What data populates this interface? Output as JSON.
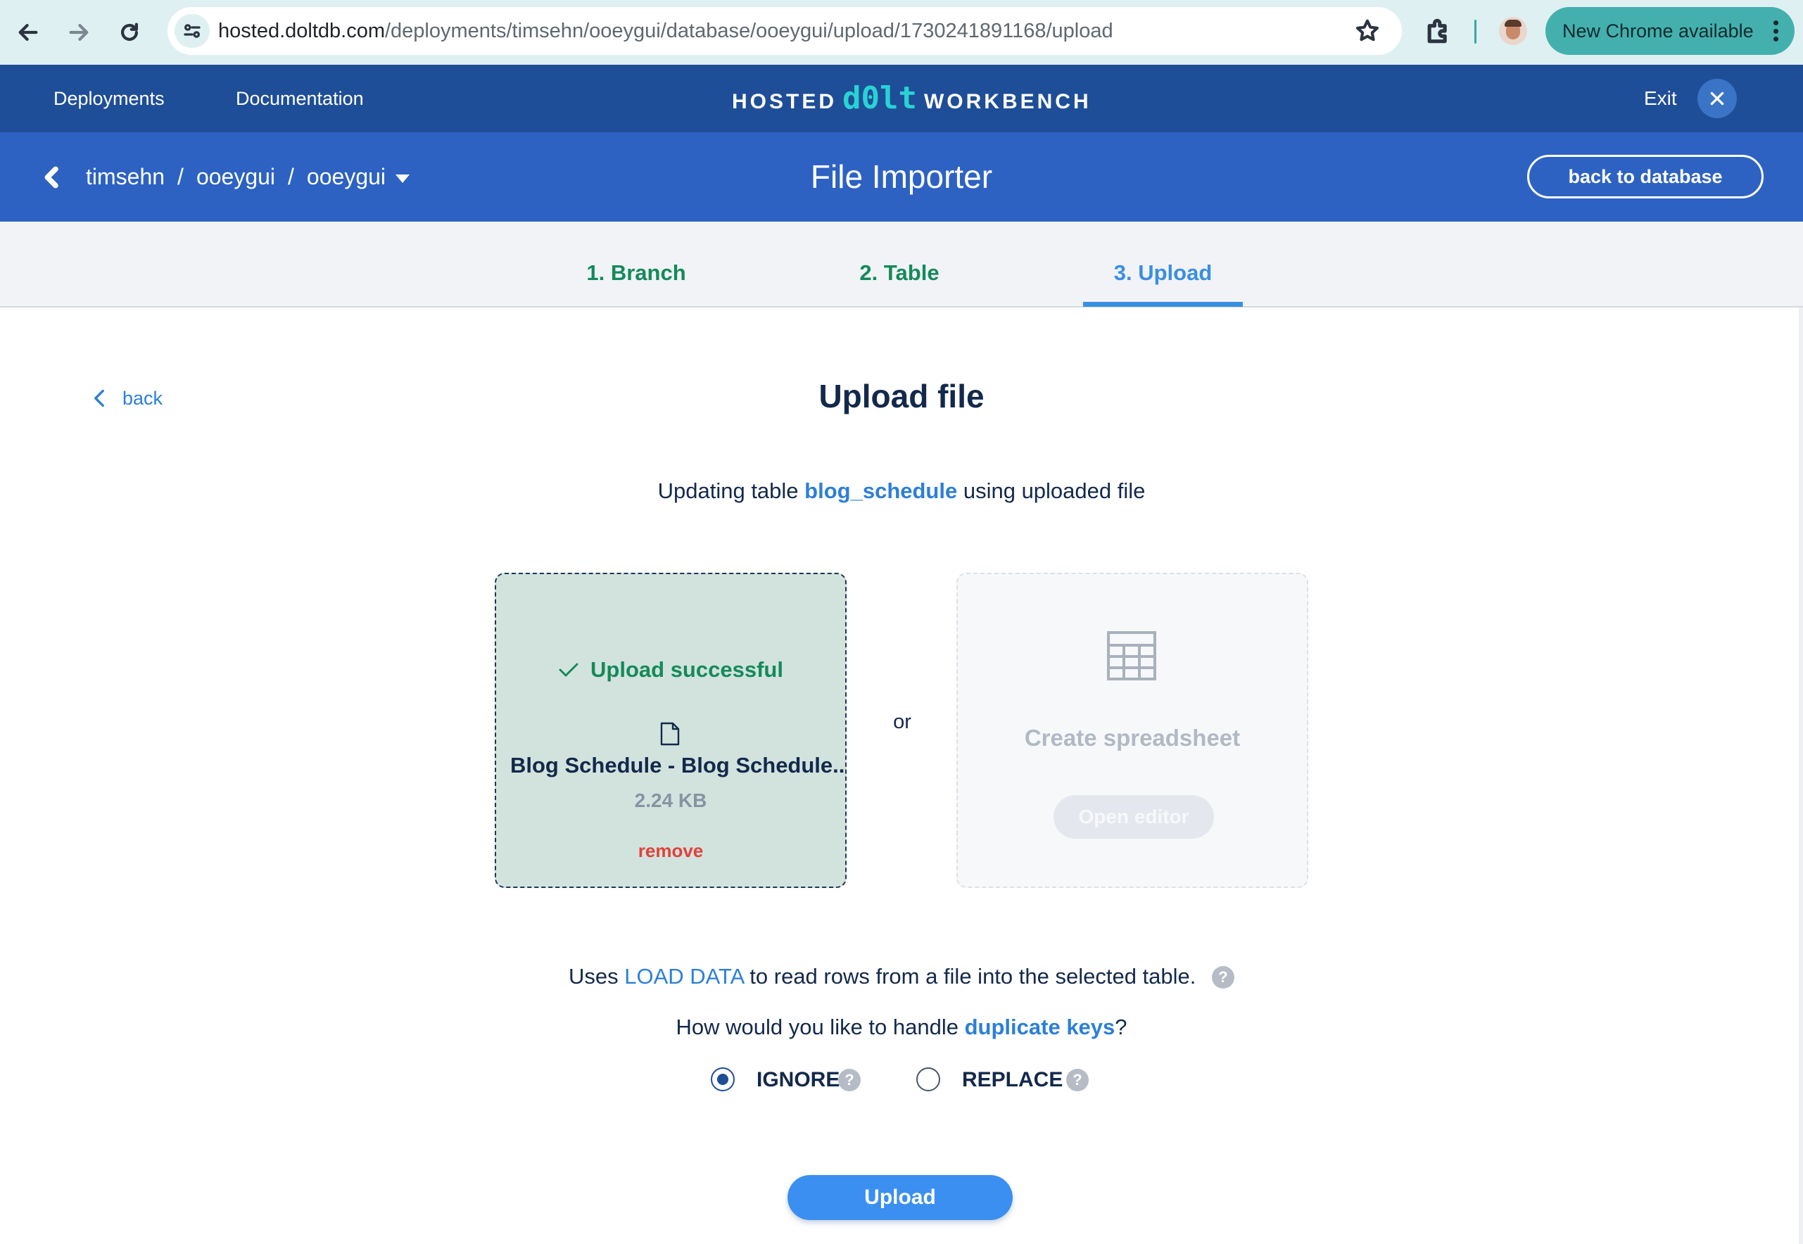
{
  "browser": {
    "url_host": "hosted.doltdb.com",
    "url_path": "/deployments/timsehn/ooeygui/database/ooeygui/upload/1730241891168/upload",
    "update_button": "New Chrome available",
    "icons": [
      "back-arrow-icon",
      "forward-arrow-icon",
      "reload-icon",
      "site-info-icon",
      "star-icon",
      "extensions-icon",
      "profile-avatar",
      "kebab-menu-icon"
    ]
  },
  "header": {
    "nav": [
      "Deployments",
      "Documentation"
    ],
    "logo_left": "HOSTED",
    "logo_mid": "d0lt",
    "logo_right": "WORKBENCH",
    "exit_label": "Exit",
    "colors": {
      "bar": "#1f4e98",
      "accent": "#29d3d3"
    }
  },
  "subheader": {
    "crumbs": [
      "timsehn",
      "ooeygui",
      "ooeygui"
    ],
    "separator": "/",
    "title": "File Importer",
    "back_to_db": "back to database",
    "color": "#2d62c2"
  },
  "steps": [
    {
      "label": "1. Branch",
      "state": "done"
    },
    {
      "label": "2. Table",
      "state": "done"
    },
    {
      "label": "3. Upload",
      "state": "active"
    }
  ],
  "main": {
    "back": "back",
    "title": "Upload file",
    "updating_prefix": "Updating table",
    "table_name": "blog_schedule",
    "updating_suffix": "using uploaded file",
    "upload_box": {
      "status": "Upload successful",
      "file_name": "Blog Schedule - Blog Schedule...",
      "file_size": "2.24 KB",
      "remove": "remove"
    },
    "or": "or",
    "spreadsheet": {
      "label": "Create spreadsheet",
      "button": "Open editor"
    },
    "uses_prefix": "Uses",
    "uses_link": "LOAD DATA",
    "uses_suffix": "to read rows from a file into the selected table.",
    "dup_prefix": "How would you like to handle",
    "dup_link": "duplicate keys",
    "dup_suffix": "?",
    "options": [
      {
        "label": "IGNORE",
        "selected": true
      },
      {
        "label": "REPLACE",
        "selected": false
      }
    ],
    "help_glyph": "?",
    "upload_button": "Upload",
    "colors": {
      "success": "#158a5a",
      "link": "#2c7fd8",
      "remove": "#e0423a",
      "primary": "#3a8ff0"
    }
  }
}
